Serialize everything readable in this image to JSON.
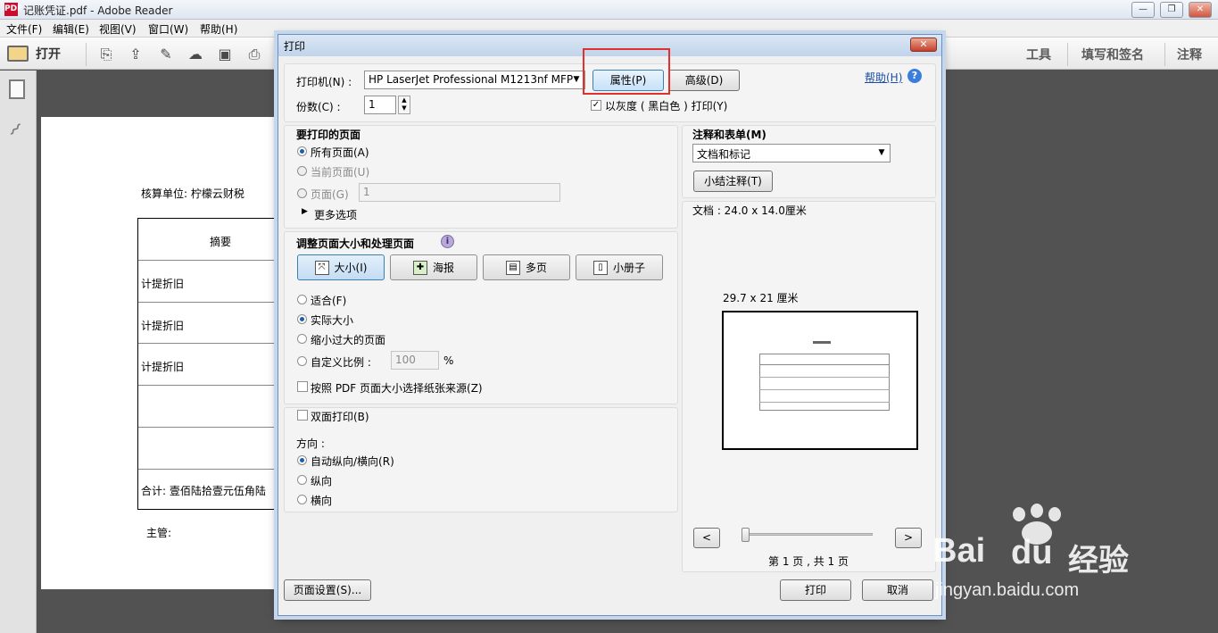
{
  "window": {
    "title": "记账凭证.pdf - Adobe Reader",
    "logo": "PDF"
  },
  "window_controls": {
    "minimize": "—",
    "restore": "❐",
    "close": "✕"
  },
  "menu": [
    "文件(F)",
    "编辑(E)",
    "视图(V)",
    "窗口(W)",
    "帮助(H)"
  ],
  "toolbar": {
    "open_label": "打开",
    "right_tools": [
      "工具",
      "填写和签名",
      "注释"
    ]
  },
  "document": {
    "unit_line": "核算单位: 柠檬云财税",
    "header": "摘要",
    "rows": [
      "计提折旧",
      "计提折旧",
      "计提折旧",
      "",
      ""
    ],
    "total": "合计: 壹佰陆拾壹元伍角陆",
    "supervisor": "主管:"
  },
  "dialog": {
    "title": "打印",
    "close": "✕",
    "printer_label": "打印机(N) :",
    "printer_value": "HP LaserJet Professional M1213nf MFP",
    "properties_button": "属性(P)",
    "advanced_button": "高级(D)",
    "help_link": "帮助(H)",
    "help_icon": "?",
    "copies_label": "份数(C) :",
    "copies_value": "1",
    "grayscale_label": "以灰度 ( 黑白色 ) 打印(Y)",
    "grayscale_checked": true,
    "pages_section": {
      "title": "要打印的页面",
      "all": "所有页面(A)",
      "current": "当前页面(U)",
      "pages": "页面(G)",
      "pages_value": "1",
      "more": "更多选项"
    },
    "sizing_section": {
      "title": "调整页面大小和处理页面",
      "info_icon": "i",
      "tabs": [
        {
          "label": "大小(I)",
          "icon": "⤧",
          "active": true
        },
        {
          "label": "海报",
          "icon": "✚",
          "active": false
        },
        {
          "label": "多页",
          "icon": "▤",
          "active": false
        },
        {
          "label": "小册子",
          "icon": "▯",
          "active": false
        }
      ],
      "fit": "适合(F)",
      "actual": "实际大小",
      "shrink": "缩小过大的页面",
      "custom": "自定义比例 :",
      "custom_value": "100",
      "percent": "%",
      "paper_source": "按照 PDF 页面大小选择纸张来源(Z)"
    },
    "duplex": "双面打印(B)",
    "orientation": {
      "label": "方向 :",
      "auto": "自动纵向/横向(R)",
      "portrait": "纵向",
      "landscape": "横向"
    },
    "comments": {
      "title": "注释和表单(M)",
      "value": "文档和标记",
      "summarize_button": "小结注释(T)"
    },
    "preview": {
      "doc_size": "文档 : 24.0 x 14.0厘米",
      "paper_size": "29.7 x 21 厘米",
      "prev": "<",
      "next": ">",
      "page_info": "第 1 页 , 共 1 页",
      "zoom_level": 0
    },
    "page_setup_button": "页面设置(S)...",
    "print_button": "打印",
    "cancel_button": "取消"
  },
  "watermark": {
    "brand": "Bai",
    "brand2": "du",
    "cn": "经验",
    "url": "jingyan.baidu.com"
  }
}
